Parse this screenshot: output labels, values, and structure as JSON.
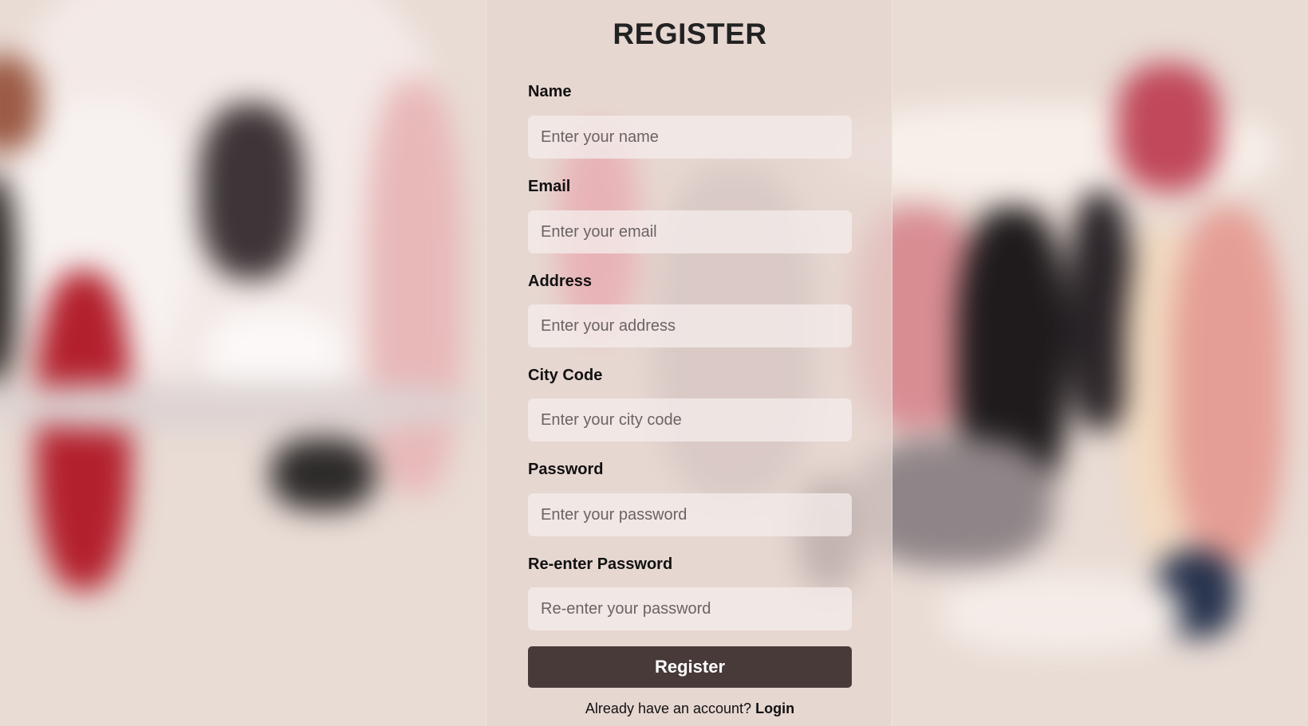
{
  "form": {
    "title": "REGISTER",
    "fields": [
      {
        "label": "Name",
        "placeholder": "Enter your name",
        "value": ""
      },
      {
        "label": "Email",
        "placeholder": "Enter your email",
        "value": ""
      },
      {
        "label": "Address",
        "placeholder": "Enter your address",
        "value": ""
      },
      {
        "label": "City Code",
        "placeholder": "Enter your city code",
        "value": ""
      },
      {
        "label": "Password",
        "placeholder": "Enter your password",
        "value": ""
      },
      {
        "label": "Re-enter Password",
        "placeholder": "Re-enter your password",
        "value": ""
      }
    ],
    "submit_label": "Register",
    "login_prompt": "Already have an account?",
    "login_link": "Login"
  },
  "colors": {
    "button": "#473a39",
    "panel": "rgba(230,214,208,0.72)",
    "input": "rgba(244,236,234,0.78)"
  }
}
